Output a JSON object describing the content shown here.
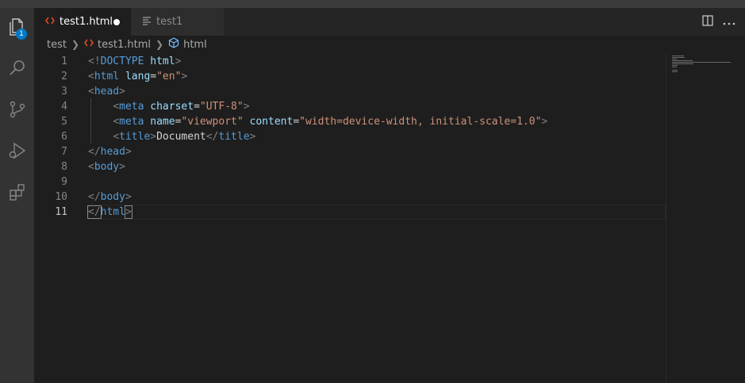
{
  "activity_bar": {
    "explorer_badge": "1",
    "items": [
      "explorer-icon",
      "search-icon",
      "source-control-icon",
      "run-debug-icon",
      "extensions-icon"
    ]
  },
  "tabs": [
    {
      "label": "test1.html",
      "icon": "html-file-icon",
      "active": true,
      "dirty": true
    },
    {
      "label": "test1",
      "icon": "text-file-icon",
      "active": false,
      "dirty": false
    }
  ],
  "tab_actions": [
    "split-editor-icon",
    "more-actions-icon"
  ],
  "breadcrumb": {
    "folder": "test",
    "file": "test1.html",
    "symbol": "html"
  },
  "editor": {
    "line_numbers": [
      "1",
      "2",
      "3",
      "4",
      "5",
      "6",
      "7",
      "8",
      "9",
      "10",
      "11"
    ],
    "current_line": 11,
    "lines": [
      [
        [
          "punc",
          "<!"
        ],
        [
          "tag",
          "DOCTYPE"
        ],
        [
          "text",
          " "
        ],
        [
          "attr",
          "html"
        ],
        [
          "punc",
          ">"
        ]
      ],
      [
        [
          "punc",
          "<"
        ],
        [
          "tag",
          "html"
        ],
        [
          "text",
          " "
        ],
        [
          "attr",
          "lang"
        ],
        [
          "text",
          "="
        ],
        [
          "str",
          "\"en\""
        ],
        [
          "punc",
          ">"
        ]
      ],
      [
        [
          "punc",
          "<"
        ],
        [
          "tag",
          "head"
        ],
        [
          "punc",
          ">"
        ]
      ],
      [
        [
          "text",
          "    "
        ],
        [
          "punc",
          "<"
        ],
        [
          "tag",
          "meta"
        ],
        [
          "text",
          " "
        ],
        [
          "attr",
          "charset"
        ],
        [
          "text",
          "="
        ],
        [
          "str",
          "\"UTF-8\""
        ],
        [
          "punc",
          ">"
        ]
      ],
      [
        [
          "text",
          "    "
        ],
        [
          "punc",
          "<"
        ],
        [
          "tag",
          "meta"
        ],
        [
          "text",
          " "
        ],
        [
          "attr",
          "name"
        ],
        [
          "text",
          "="
        ],
        [
          "str",
          "\"viewport\""
        ],
        [
          "text",
          " "
        ],
        [
          "attr",
          "content"
        ],
        [
          "text",
          "="
        ],
        [
          "str",
          "\"width=device-width, initial-scale=1.0\""
        ],
        [
          "punc",
          ">"
        ]
      ],
      [
        [
          "text",
          "    "
        ],
        [
          "punc",
          "<"
        ],
        [
          "tag",
          "title"
        ],
        [
          "punc",
          ">"
        ],
        [
          "text",
          "Document"
        ],
        [
          "punc",
          "</"
        ],
        [
          "tag",
          "title"
        ],
        [
          "punc",
          ">"
        ]
      ],
      [
        [
          "punc",
          "</"
        ],
        [
          "tag",
          "head"
        ],
        [
          "punc",
          ">"
        ]
      ],
      [
        [
          "punc",
          "<"
        ],
        [
          "tag",
          "body"
        ],
        [
          "punc",
          ">"
        ]
      ],
      [],
      [
        [
          "punc",
          "</"
        ],
        [
          "tag",
          "body"
        ],
        [
          "punc",
          ">"
        ]
      ],
      [
        [
          "punc",
          "</"
        ],
        [
          "tag",
          "html"
        ],
        [
          "punc",
          ">"
        ]
      ]
    ]
  },
  "colors": {
    "background": "#1e1e1e",
    "activity_bar": "#333333",
    "accent": "#007acc",
    "tag": "#569cd6",
    "attribute": "#9cdcfe",
    "string": "#ce9178",
    "punctuation": "#808080",
    "text": "#d4d4d4"
  }
}
